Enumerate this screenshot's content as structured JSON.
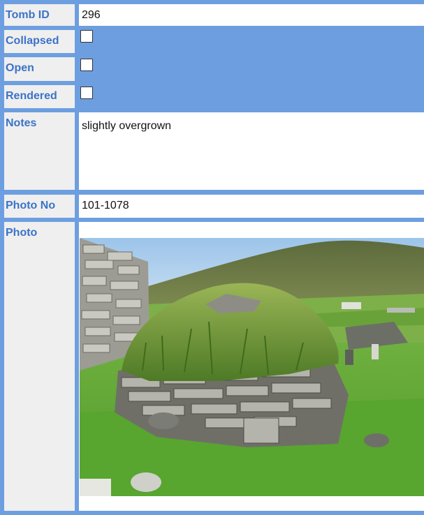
{
  "fields": {
    "tomb_id": {
      "label": "Tomb ID",
      "value": "296"
    },
    "collapsed": {
      "label": "Collapsed",
      "checked": false
    },
    "open": {
      "label": "Open",
      "checked": false
    },
    "rendered": {
      "label": "Rendered",
      "checked": false
    },
    "notes": {
      "label": "Notes",
      "value": "slightly overgrown"
    },
    "photo_no": {
      "label": "Photo No",
      "value": "101-1078"
    },
    "photo": {
      "label": "Photo"
    }
  },
  "colors": {
    "frame": "#6d9fe0",
    "label_bg": "#efefef",
    "label_text": "#3b73c8"
  }
}
